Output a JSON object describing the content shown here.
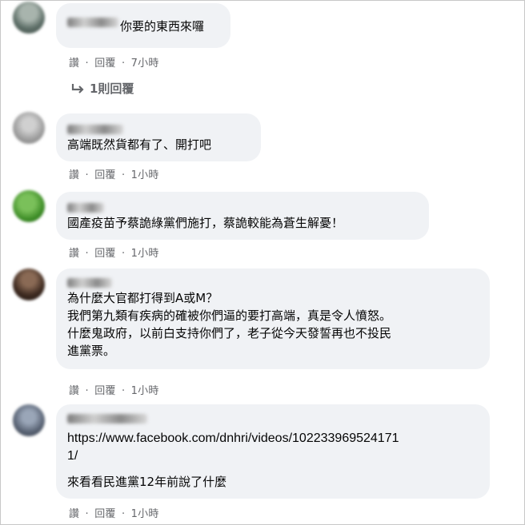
{
  "comments": [
    {
      "text_lines": [
        "你要的東西來囉"
      ],
      "actions": {
        "like": "讚",
        "reply": "回覆",
        "time": "7小時"
      },
      "avatar_color": "#6b7b74"
    },
    {
      "text_lines": [
        "高端既然貨都有了、開打吧"
      ],
      "actions": {
        "like": "讚",
        "reply": "回覆",
        "time": "1小時"
      },
      "avatar_color": "#9a9a9a"
    },
    {
      "text_lines": [
        "國產疫苗予蔡詭綠黨們施打，蔡詭較能為蒼生解憂！"
      ],
      "actions": {
        "like": "讚",
        "reply": "回覆",
        "time": "1小時"
      },
      "avatar_color": "#3f8c2a"
    },
    {
      "text_lines": [
        "為什麼大官都打得到A或M？",
        "我們第九類有疾病的確被你們逼的要打高端，真是令人憤怒。",
        "什麼鬼政府，以前白支持你們了，老子從今天發誓再也不投民",
        "進黨票。"
      ],
      "actions": {
        "like": "讚",
        "reply": "回覆",
        "time": "1小時"
      },
      "avatar_color": "#3a2a22"
    },
    {
      "text_lines": [
        "https://www.facebook.com/dnhri/videos/102233969524171",
        "1/",
        "",
        "來看看民進黨12年前說了什麼"
      ],
      "actions": {
        "like": "讚",
        "reply": "回覆",
        "time": "1小時"
      },
      "avatar_color": "#556070"
    }
  ],
  "reply_count_label": "1則回覆",
  "separator": "·",
  "icons": {
    "reply_arrow": "reply-arrow-icon"
  }
}
